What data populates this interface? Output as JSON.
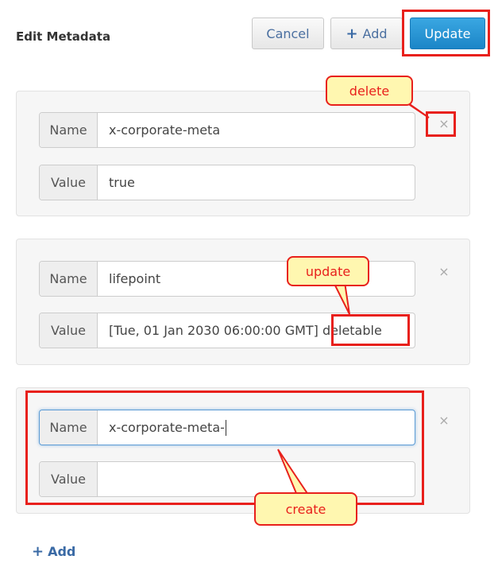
{
  "header": {
    "title": "Edit Metadata",
    "cancel_label": "Cancel",
    "add_label": "Add",
    "update_label": "Update"
  },
  "entries": [
    {
      "name_label": "Name",
      "name_value": "x-corporate-meta",
      "value_label": "Value",
      "value_value": "true"
    },
    {
      "name_label": "Name",
      "name_value": "lifepoint",
      "value_label": "Value",
      "value_value": "[Tue, 01 Jan 2030 06:00:00 GMT] deletable"
    },
    {
      "name_label": "Name",
      "name_value": "x-corporate-meta-",
      "value_label": "Value",
      "value_value": ""
    }
  ],
  "close_glyph": "×",
  "callouts": {
    "delete": "delete",
    "update": "update",
    "create": "create"
  },
  "footer": {
    "add_label": "Add"
  },
  "icons": {
    "plus": "plus-icon",
    "close": "close-icon"
  },
  "colors": {
    "highlight": "#e8201c",
    "callout_bg": "#fff7b0",
    "primary": "#1b85c7"
  }
}
